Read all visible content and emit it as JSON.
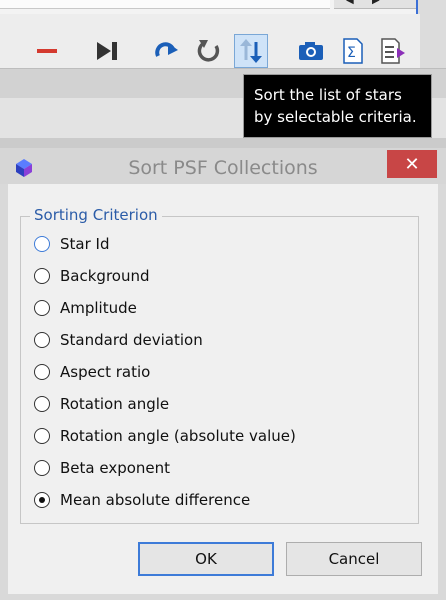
{
  "background_window": {
    "scroll_arrows": [
      "◀",
      "▶"
    ],
    "toolbar_icons": [
      "minus-icon",
      "skip-to-end-icon",
      "redo-icon",
      "undo-icon",
      "sort-icon",
      "camera-icon",
      "sigma-document-icon",
      "export-document-icon"
    ]
  },
  "tooltip": {
    "text": "Sort the list of stars\nby selectable criteria."
  },
  "dialog": {
    "title": "Sort PSF Collections",
    "close_label": "✕",
    "group_title": "Sorting Criterion",
    "options": [
      {
        "label": "Star Id",
        "checked": false
      },
      {
        "label": "Background",
        "checked": false
      },
      {
        "label": "Amplitude",
        "checked": false
      },
      {
        "label": "Standard deviation",
        "checked": false
      },
      {
        "label": "Aspect ratio",
        "checked": false
      },
      {
        "label": "Rotation angle",
        "checked": false
      },
      {
        "label": "Rotation angle (absolute value)",
        "checked": false
      },
      {
        "label": "Beta exponent",
        "checked": false
      },
      {
        "label": "Mean absolute difference",
        "checked": true
      }
    ],
    "ok_label": "OK",
    "cancel_label": "Cancel"
  },
  "colors": {
    "close_button": "#c84646",
    "accent": "#3d7bd8",
    "legend_text": "#2b5ca8"
  }
}
